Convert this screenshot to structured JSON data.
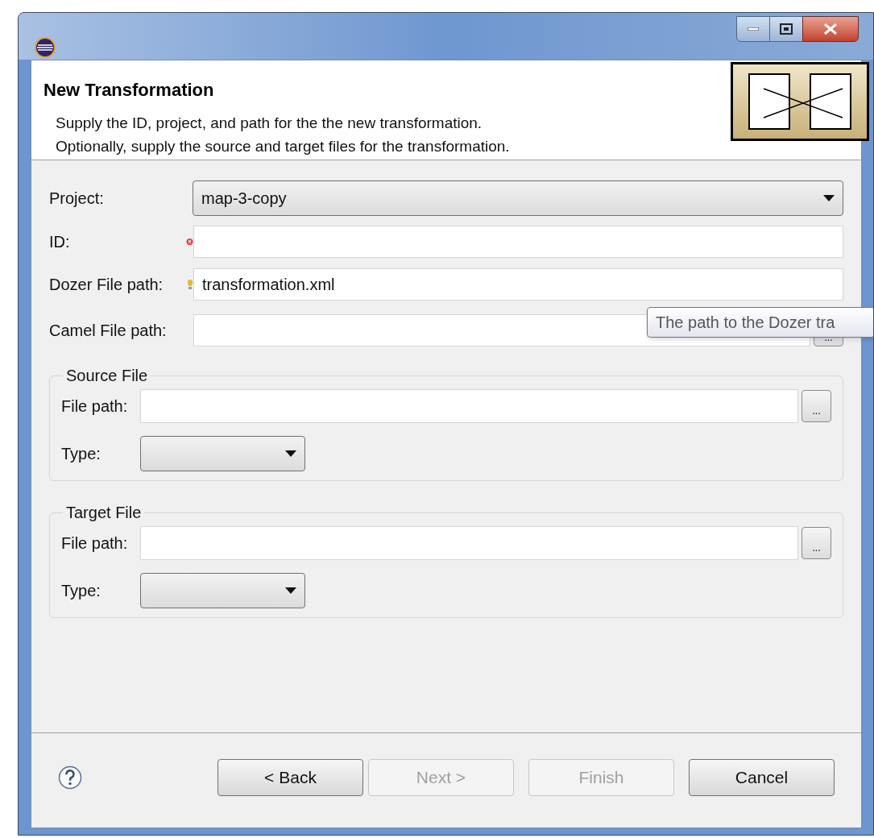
{
  "header": {
    "title": "New Transformation",
    "description": [
      "Supply the ID, project, and path for the the new transformation.",
      "Optionally, supply the source and target files for the transformation."
    ]
  },
  "fields": [
    {
      "label": "Project:",
      "kind": "combo",
      "value": "map-3-copy"
    },
    {
      "label": "ID:",
      "kind": "text",
      "error": true
    },
    {
      "label": "Dozer File path:",
      "kind": "text",
      "hint": true,
      "value": "transformation.xml"
    },
    {
      "label": "Camel File path:",
      "kind": "browse",
      "browse_label": "..."
    }
  ],
  "groups": [
    {
      "title": "Source File",
      "path_label": "File path:",
      "browse_label": "...",
      "type_label": "Type:"
    },
    {
      "title": "Target File",
      "path_label": "File path:",
      "browse_label": "...",
      "type_label": "Type:"
    }
  ],
  "tooltip": "The path to the Dozer tra",
  "buttons": [
    {
      "label": "< Back",
      "disabled": false
    },
    {
      "label": "Next >",
      "disabled": true
    },
    {
      "label": "Finish",
      "disabled": true
    },
    {
      "label": "Cancel",
      "disabled": false
    }
  ]
}
